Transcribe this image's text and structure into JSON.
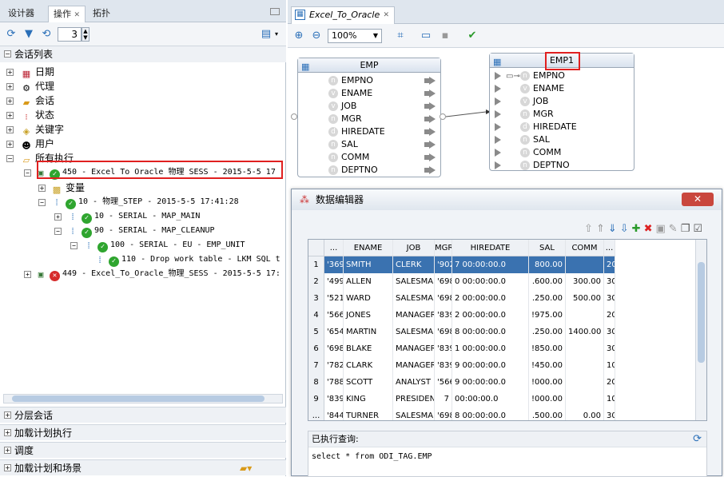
{
  "left": {
    "tabs": [
      "设计器",
      "操作",
      "拓扑"
    ],
    "counter": "3",
    "session_list": "会话列表",
    "categories": [
      "日期",
      "代理",
      "会话",
      "状态",
      "关键字",
      "用户",
      "所有执行"
    ],
    "sess1": "450 - Excel To Oracle 物理 SESS - 2015-5-5 17",
    "var": "变量",
    "step": "10 - 物理_STEP - 2015-5-5 17:41:28",
    "t1": "10 - SERIAL - MAP_MAIN",
    "t2": "90 - SERIAL - MAP_CLEANUP",
    "t3": "100 - SERIAL - EU - EMP_UNIT",
    "t4": "110 - Drop work table - LKM SQL t",
    "sess2": "449 - Excel_To_Oracle_物理_SESS - 2015-5-5 17:",
    "bottom": [
      "分层会话",
      "加载计划执行",
      "调度",
      "加载计划和场景"
    ]
  },
  "right": {
    "tab": "Excel_To_Oracle",
    "zoom": "100%",
    "emp": {
      "title": "EMP",
      "cols": [
        "EMPNO",
        "ENAME",
        "JOB",
        "MGR",
        "HIREDATE",
        "SAL",
        "COMM",
        "DEPTNO"
      ]
    },
    "emp1": {
      "title": "EMP1",
      "cols": [
        "EMPNO",
        "ENAME",
        "JOB",
        "MGR",
        "HIREDATE",
        "SAL",
        "COMM",
        "DEPTNO"
      ]
    }
  },
  "dialog": {
    "title": "数据编辑器",
    "headers": [
      "...",
      "ENAME",
      "JOB",
      "MGR",
      "HIREDATE",
      "SAL",
      "COMM",
      "..."
    ],
    "rows": [
      [
        "1",
        "'369",
        "SMITH",
        "CLERK",
        "'902",
        "7  00:00:00.0",
        "800.00",
        "",
        "20"
      ],
      [
        "2",
        "'499",
        "ALLEN",
        "SALESMAN",
        "'698",
        "0  00:00:00.0",
        ".600.00",
        "300.00",
        "30"
      ],
      [
        "3",
        "'521",
        "WARD",
        "SALESMAN",
        "'698",
        "2  00:00:00.0",
        ".250.00",
        "500.00",
        "30"
      ],
      [
        "4",
        "'566",
        "JONES",
        "MANAGER",
        "'839",
        "2  00:00:00.0",
        "!975.00",
        "",
        "20"
      ],
      [
        "5",
        "'654",
        "MARTIN",
        "SALESMAN",
        "'698",
        "8  00:00:00.0",
        ".250.00",
        "1400.00",
        "30"
      ],
      [
        "6",
        "'698",
        "BLAKE",
        "MANAGER",
        "'839",
        "1  00:00:00.0",
        "!850.00",
        "",
        "30"
      ],
      [
        "7",
        "'782",
        "CLARK",
        "MANAGER",
        "'839",
        "9  00:00:00.0",
        "!450.00",
        "",
        "10"
      ],
      [
        "8",
        "'788",
        "SCOTT",
        "ANALYST",
        "'566",
        "9  00:00:00.0",
        "!000.00",
        "",
        "20"
      ],
      [
        "9",
        "'839",
        "KING",
        "PRESIDENT",
        "7",
        "00:00:00.0",
        "!000.00",
        "",
        "10"
      ],
      [
        "...",
        "'844",
        "TURNER",
        "SALESMAN",
        "'698",
        "8  00:00:00.0",
        ".500.00",
        "0.00",
        "30"
      ]
    ],
    "query_label": "已执行查询:",
    "query": "select * from ODI_TAG.EMP"
  }
}
